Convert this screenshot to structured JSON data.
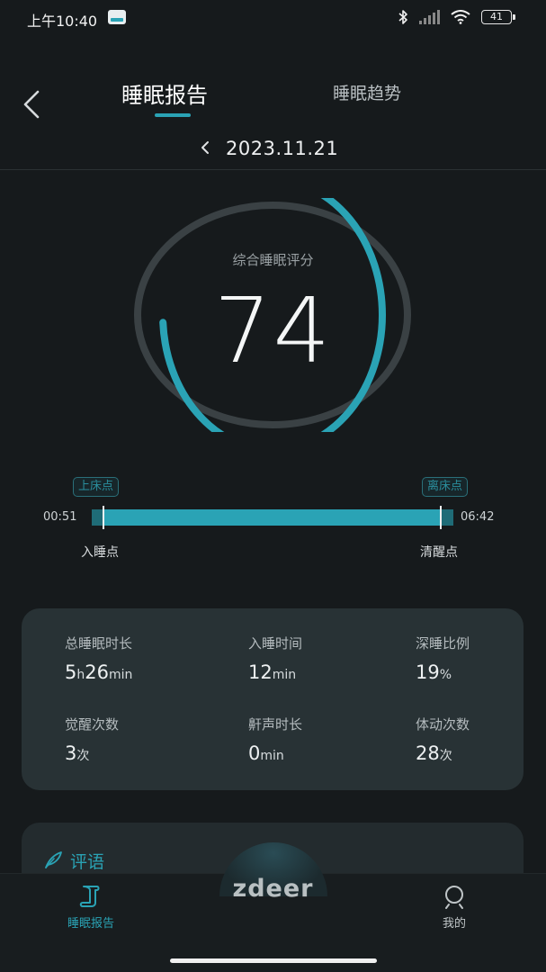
{
  "status_bar": {
    "time": "上午10:40",
    "battery": "41"
  },
  "header": {
    "tabs": [
      {
        "label": "睡眠报告",
        "active": true
      },
      {
        "label": "睡眠趋势",
        "active": false
      }
    ],
    "date": "2023.11.21"
  },
  "score": {
    "label": "综合睡眠评分",
    "value": "74",
    "ring_fraction": 0.74,
    "accent_color": "#2aa3b5"
  },
  "timeline": {
    "bed_label": "上床点",
    "leave_label": "离床点",
    "start_time": "00:51",
    "end_time": "06:42",
    "sleep_label": "入睡点",
    "wake_label": "清醒点"
  },
  "stats": [
    {
      "label": "总睡眠时长",
      "parts": [
        {
          "v": "5"
        },
        {
          "u": "h"
        },
        {
          "v": "26"
        },
        {
          "u": "min"
        }
      ]
    },
    {
      "label": "入睡时间",
      "parts": [
        {
          "v": "12"
        },
        {
          "u": "min"
        }
      ]
    },
    {
      "label": "深睡比例",
      "parts": [
        {
          "v": "19"
        },
        {
          "u": "%"
        }
      ]
    },
    {
      "label": "觉醒次数",
      "parts": [
        {
          "v": "3"
        },
        {
          "u": "次"
        }
      ]
    },
    {
      "label": "鼾声时长",
      "parts": [
        {
          "v": "0"
        },
        {
          "u": "min"
        }
      ]
    },
    {
      "label": "体动次数",
      "parts": [
        {
          "v": "28"
        },
        {
          "u": "次"
        }
      ]
    }
  ],
  "comment": {
    "title": "评语"
  },
  "bottom_nav": {
    "brand": "zdeer",
    "items": [
      {
        "label": "睡眠报告",
        "active": true
      },
      {
        "label": "我的",
        "active": false
      }
    ]
  }
}
